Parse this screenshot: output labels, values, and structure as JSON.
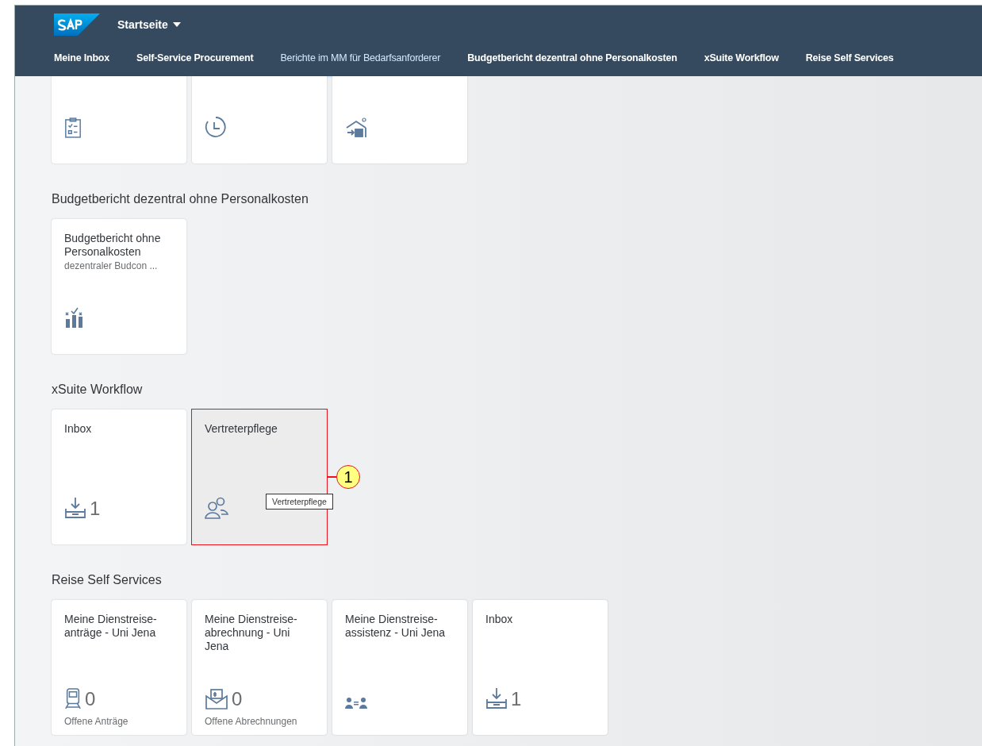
{
  "header": {
    "title": "Startseite",
    "tabs": [
      {
        "label": "Meine Inbox",
        "selected": false
      },
      {
        "label": "Self-Service Procurement",
        "selected": false
      },
      {
        "label": "Berichte im MM für Bedarfsanforderer",
        "selected": true
      },
      {
        "label": "Budgetbericht dezentral ohne Personalkosten",
        "selected": false
      },
      {
        "label": "xSuite Workflow",
        "selected": false
      },
      {
        "label": "Reise Self Services",
        "selected": false
      }
    ]
  },
  "groups": [
    {
      "clipped": true,
      "tiles": [
        {
          "hovered": false
        },
        {
          "hovered": false
        },
        {
          "hovered": false
        }
      ]
    },
    {
      "title": "Budgetbericht dezentral ohne Personalkosten",
      "tiles": [
        {
          "title": "Budgetbericht ohne Personalkosten",
          "subtitle": "dezentraler Budcon ...",
          "hovered": false
        }
      ]
    },
    {
      "title": "xSuite Workflow",
      "tiles": [
        {
          "title": "Inbox",
          "number": "1",
          "hovered": false
        },
        {
          "title": "Vertreterpflege",
          "hovered": true,
          "callout": "1",
          "tooltip": "Vertreterpflege"
        }
      ]
    },
    {
      "title": "Reise Self Services",
      "tiles": [
        {
          "title": "Meine Dienstreise-anträge - Uni Jena",
          "number": "0",
          "footer": "Offene Anträge",
          "hovered": false
        },
        {
          "title": "Meine Dienstreise-abrechnung - Uni Jena",
          "number": "0",
          "footer": "Offene Abrechnungen",
          "hovered": false
        },
        {
          "title": "Meine Dienstreise-assistenz - Uni Jena",
          "hovered": false
        },
        {
          "title": "Inbox",
          "number": "1",
          "hovered": false
        }
      ]
    }
  ]
}
